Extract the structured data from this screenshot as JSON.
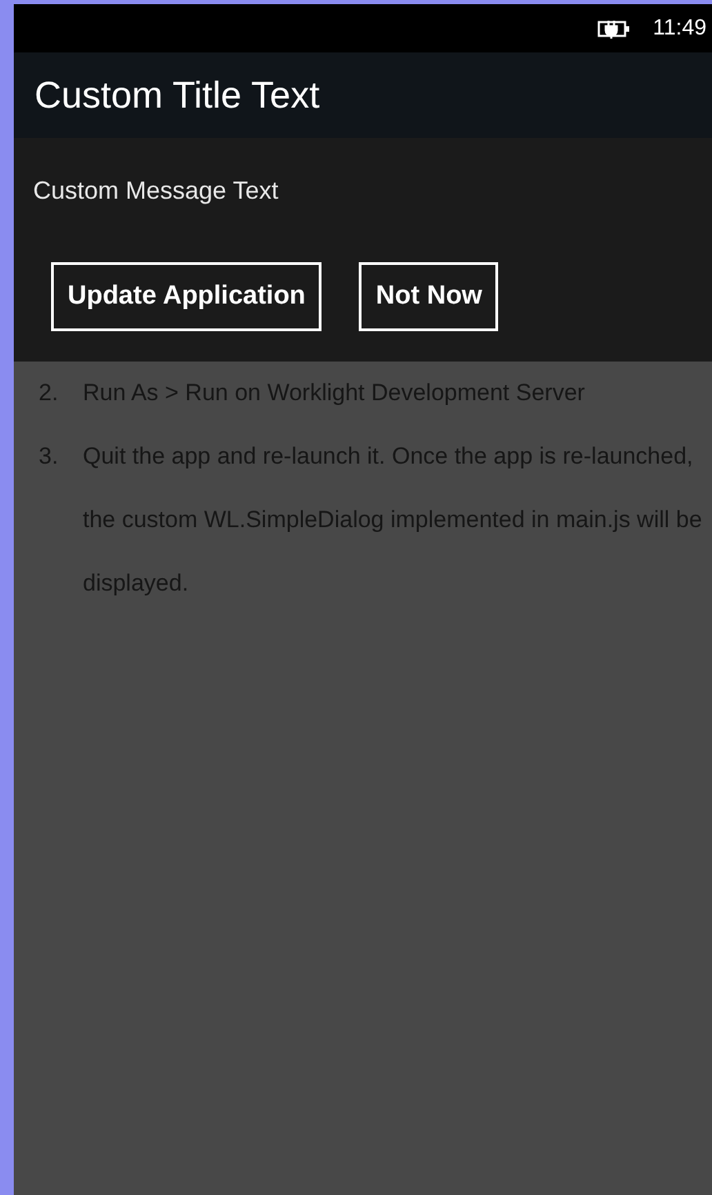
{
  "status_bar": {
    "time": "11:49"
  },
  "dialog": {
    "title": "Custom Title Text",
    "message": "Custom Message Text",
    "buttons": [
      {
        "label": "Update Application"
      },
      {
        "label": "Not Now"
      }
    ]
  },
  "steps": [
    {
      "number": "2.",
      "text": "Run As > Run on Worklight Development Server"
    },
    {
      "number": "3.",
      "text": "Quit the app and re-launch it. Once the app is re-launched, the custom WL.SimpleDialog implemented in main.js will be displayed."
    }
  ]
}
